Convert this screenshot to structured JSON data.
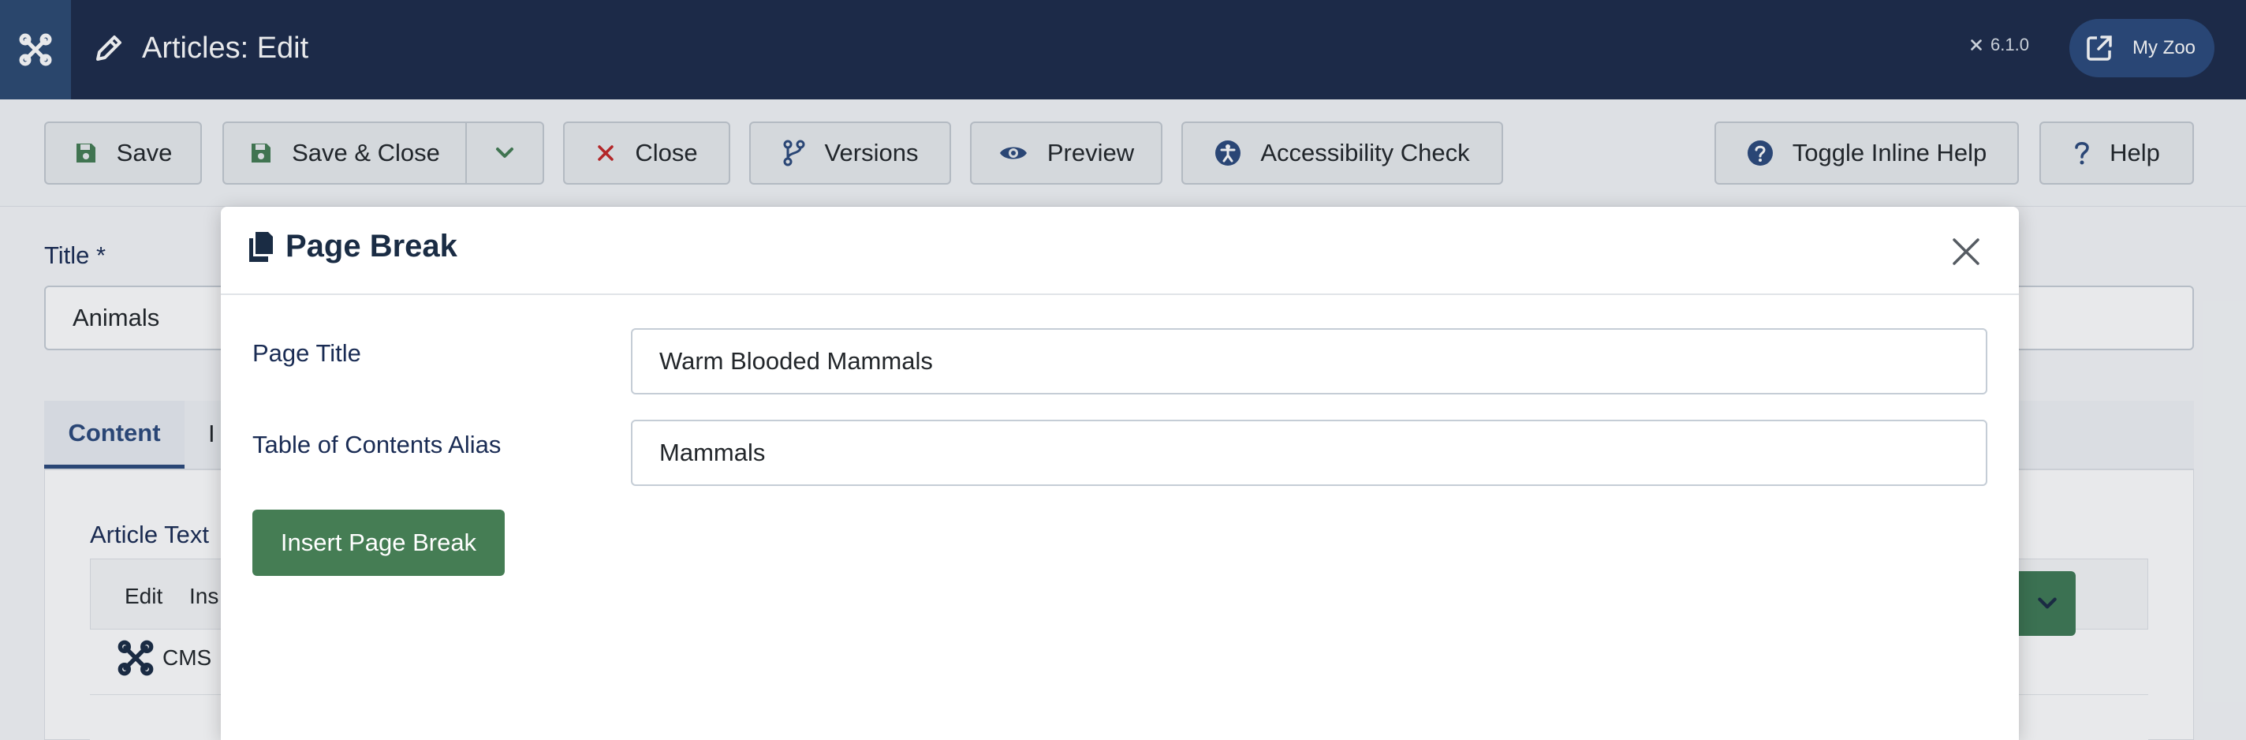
{
  "header": {
    "title": "Articles: Edit",
    "version": "6.1.0",
    "site_button": "My Zoo"
  },
  "toolbar": {
    "save": "Save",
    "save_close": "Save & Close",
    "close": "Close",
    "versions": "Versions",
    "preview": "Preview",
    "accessibility": "Accessibility Check",
    "toggle_help": "Toggle Inline Help",
    "help": "Help"
  },
  "form": {
    "title_label": "Title *",
    "title_value": "Animals",
    "tab_content": "Content",
    "tab_second_partial": "I",
    "article_text_label": "Article Text",
    "editor_menu_edit": "Edit",
    "editor_menu_insert_partial": "Ins",
    "editor_cms_partial": "CMS"
  },
  "modal": {
    "title": "Page Break",
    "page_title_label": "Page Title",
    "page_title_value": "Warm Blooded Mammals",
    "toc_alias_label": "Table of Contents Alias",
    "toc_alias_value": "Mammals",
    "insert_button": "Insert Page Break"
  },
  "colors": {
    "header_bg": "#1c2b4a",
    "accent": "#2c4a7c",
    "success": "#457d54",
    "danger": "#c52827"
  },
  "icons": {
    "logo": "joomla-logo-icon",
    "edit": "pencil-icon",
    "save": "floppy-disk-icon",
    "dropdown": "chevron-down-icon",
    "close": "times-icon",
    "versions": "code-branch-icon",
    "preview": "eye-icon",
    "accessibility": "universal-access-icon",
    "toggle_help": "question-circle-icon",
    "help": "question-icon",
    "external": "external-link-icon",
    "modal_title": "copy-icon",
    "modal_close": "close-icon"
  }
}
